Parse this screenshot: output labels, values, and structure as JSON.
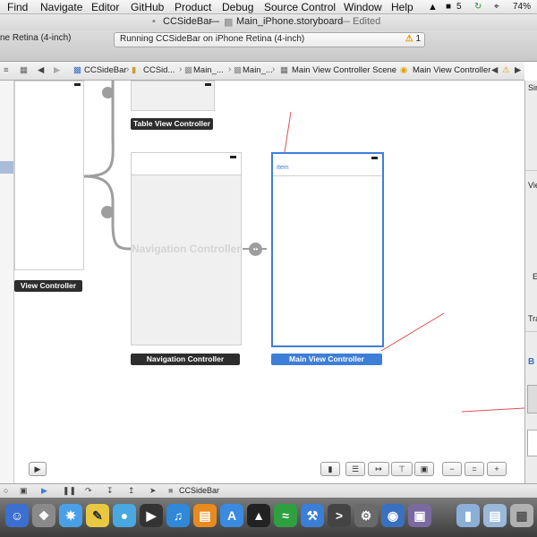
{
  "menubar": {
    "items": [
      "Find",
      "Navigate",
      "Editor",
      "GitHub",
      "Product",
      "Debug",
      "Source Control",
      "Window",
      "Help"
    ],
    "status": {
      "adobe_badge": "5",
      "battery": "74%"
    }
  },
  "window": {
    "title_project": "CCSideBar",
    "title_separator": "—",
    "title_file": "Main_iPhone.storyboard",
    "title_state": "— Edited"
  },
  "toolbar": {
    "scheme": "ne Retina (4-inch)",
    "activity": "Running CCSideBar on iPhone Retina (4-inch)",
    "warning_count": "1"
  },
  "jumpbar": {
    "crumbs": [
      "CCSideBar",
      "CCSid...",
      "Main_...",
      "Main_...",
      "Main View Controller Scene",
      "Main View Controller"
    ]
  },
  "canvas": {
    "scenes": {
      "table_view_controller": "Table View Controller",
      "navigation_controller_title": "Navigation Controller",
      "navigation_controller_label": "Navigation Controller",
      "view_controller_label": "View Controller",
      "main_view_controller_label": "Main View Controller",
      "nav_item": "Item"
    }
  },
  "inspector": {
    "fragments": [
      "Sim",
      "Vie",
      "E",
      "Tra",
      "B"
    ]
  },
  "debugbar": {
    "target": "CCSideBar"
  },
  "colors": {
    "accent": "#3d7fd8",
    "annotation_arrow": "#e05050",
    "warning": "#e0a000"
  }
}
